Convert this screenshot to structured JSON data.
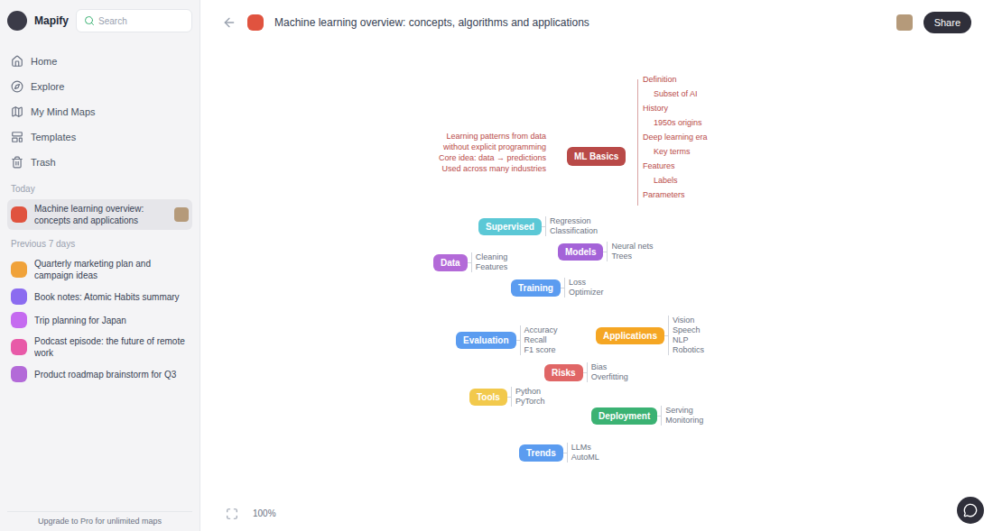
{
  "app": {
    "name": "Mapify"
  },
  "search": {
    "placeholder": "Search"
  },
  "nav": [
    {
      "label": "Home"
    },
    {
      "label": "Explore"
    },
    {
      "label": "My Mind Maps"
    },
    {
      "label": "Templates"
    },
    {
      "label": "Trash"
    }
  ],
  "sections": [
    {
      "label": "Today",
      "items": [
        {
          "title": "Machine learning overview: concepts and applications",
          "selected": true,
          "color": "#e0533f"
        }
      ]
    },
    {
      "label": "Previous 7 days",
      "items": [
        {
          "title": "Quarterly marketing plan and campaign ideas",
          "selected": false,
          "color": "#f0a23a"
        },
        {
          "title": "Book notes: Atomic Habits summary",
          "selected": false,
          "color": "#8b6cf0"
        },
        {
          "title": "Trip planning for Japan",
          "selected": false,
          "color": "#c56bf0"
        },
        {
          "title": "Podcast episode: the future of remote work",
          "selected": false,
          "color": "#e85aa8"
        },
        {
          "title": "Product roadmap brainstorm for Q3",
          "selected": false,
          "color": "#b36ad8"
        }
      ]
    }
  ],
  "footer": "Upgrade to Pro for unlimited maps",
  "header": {
    "title": "Machine learning overview: concepts, algorithms and applications",
    "share": "Share"
  },
  "mindmap": {
    "root": {
      "label": "ML Basics",
      "color": "#b94a48"
    },
    "notes": [
      "Learning patterns from data",
      "without explicit programming",
      "Core idea: data → predictions",
      "Used across many industries"
    ],
    "details": [
      "Definition",
      "Subset of AI",
      "History",
      "1950s origins",
      "Deep learning era",
      "Key terms",
      "Features",
      "Labels",
      "Parameters"
    ],
    "branches": [
      {
        "label": "Supervised",
        "color": "#5bc8d6",
        "children": [
          "Regression",
          "Classification"
        ]
      },
      {
        "label": "Models",
        "color": "#a463d8",
        "children": [
          "Neural nets",
          "Trees"
        ]
      },
      {
        "label": "Data",
        "color": "#b36ad8",
        "children": [
          "Cleaning",
          "Features"
        ]
      },
      {
        "label": "Training",
        "color": "#5b9cf0",
        "children": [
          "Loss",
          "Optimizer"
        ]
      },
      {
        "label": "Applications",
        "color": "#f5a623",
        "children": [
          "Vision",
          "Speech",
          "NLP",
          "Robotics"
        ]
      },
      {
        "label": "Evaluation",
        "color": "#5b9cf0",
        "children": [
          "Accuracy",
          "Recall",
          "F1 score"
        ]
      },
      {
        "label": "Risks",
        "color": "#e06666",
        "children": [
          "Bias",
          "Overfitting"
        ]
      },
      {
        "label": "Tools",
        "color": "#f2c94c",
        "children": [
          "Python",
          "PyTorch"
        ]
      },
      {
        "label": "Deployment",
        "color": "#3bb273",
        "children": [
          "Serving",
          "Monitoring"
        ]
      },
      {
        "label": "Trends",
        "color": "#5b9cf0",
        "children": [
          "LLMs",
          "AutoML"
        ]
      }
    ]
  },
  "zoom": "100%"
}
